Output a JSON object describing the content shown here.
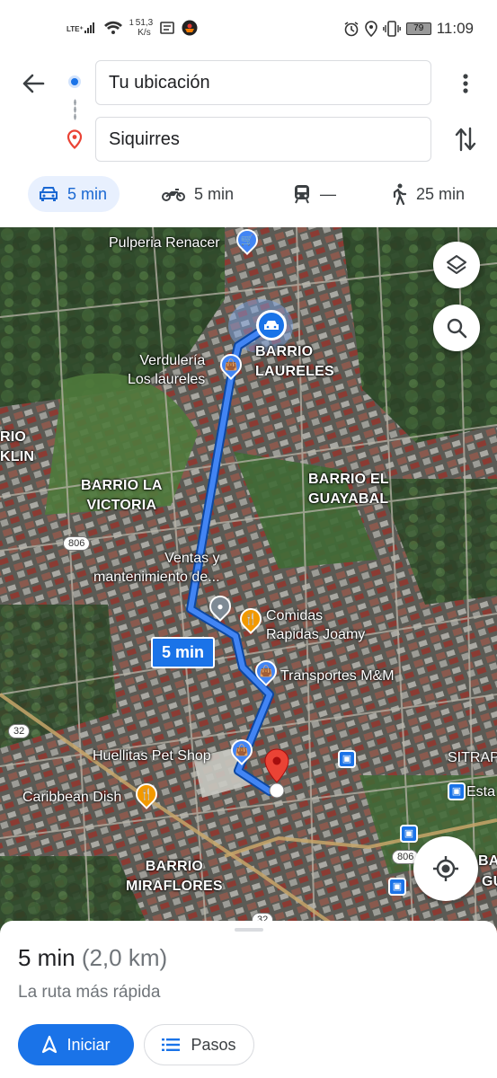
{
  "status_bar": {
    "network": "LTE⁺",
    "speed_value": "51,3",
    "speed_unit": "K/s",
    "sim_label": "1",
    "battery": "79",
    "time": "11:09",
    "icons": [
      "signal-icon",
      "wifi-icon",
      "notification-icon",
      "app-icon",
      "alarm-icon",
      "location-icon",
      "vibrate-icon",
      "battery-icon"
    ]
  },
  "directions": {
    "origin": "Tu ubicación",
    "destination": "Siquirres"
  },
  "travel_modes": [
    {
      "mode": "car",
      "label": "5 min",
      "active": true
    },
    {
      "mode": "motorcycle",
      "label": "5 min",
      "active": false
    },
    {
      "mode": "transit",
      "label": "—",
      "active": false
    },
    {
      "mode": "walk",
      "label": "25 min",
      "active": false
    }
  ],
  "map": {
    "route_duration": "5 min",
    "areas": {
      "laureles": "BARRIO\nLAURELES",
      "el_guayabal": "BARRIO EL\nGUAYABAL",
      "la_victoria": "BARRIO LA\nVICTORIA",
      "miraflores": "BARRIO\nMIRAFLORES",
      "franklin": "RIO\nKLIN"
    },
    "places": {
      "pulperia": "Pulperia Renacer",
      "verduleria": "Verdulería\nLos laureles",
      "ventas": "Ventas y\nmantenimiento de...",
      "comidas": "Comidas\nRapidas Joamy",
      "transportes": "Transportes M&M",
      "huellitas": "Huellitas Pet Shop",
      "caribbean": "Caribbean Dish",
      "sitrap": "SITRAP",
      "esta": "Esta"
    },
    "road_shields": {
      "r806a": "806",
      "r806b": "806",
      "r32a": "32",
      "r32b": "32"
    },
    "edge_labels": {
      "right_top": "BAR",
      "right_bottom": "GU"
    },
    "colors": {
      "route": "#1a73e8",
      "destination_pin": "#ea4335",
      "shopping_pin": "#4285f4",
      "food_pin": "#f29900"
    }
  },
  "sheet": {
    "duration": "5 min",
    "distance": "(2,0 km)",
    "subtitle": "La ruta más rápida",
    "start_label": "Iniciar",
    "steps_label": "Pasos"
  }
}
